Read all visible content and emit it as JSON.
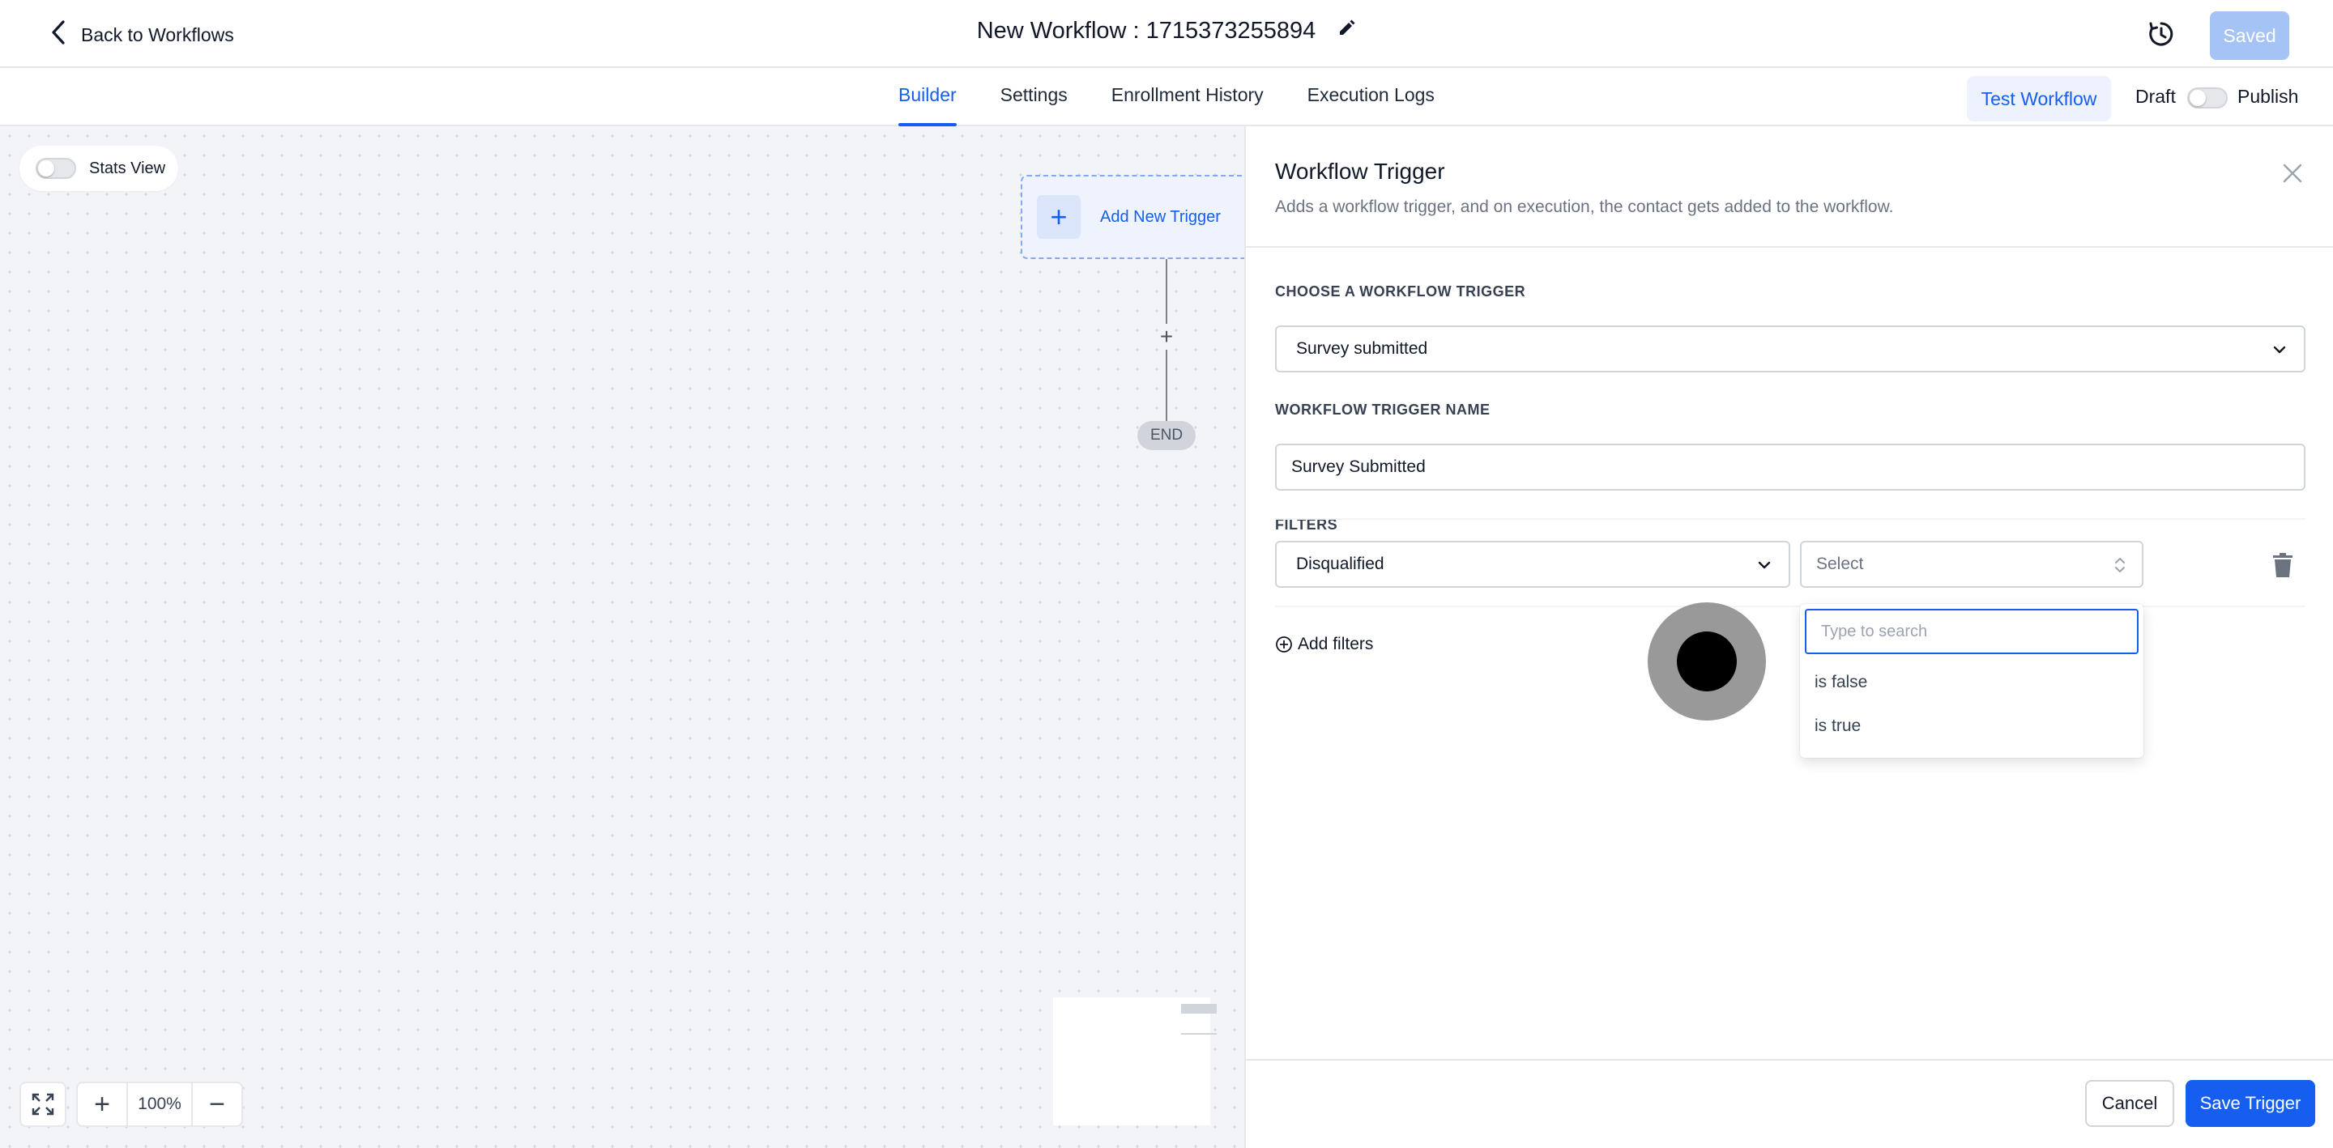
{
  "header": {
    "back_label": "Back to Workflows",
    "workflow_title": "New Workflow : 1715373255894",
    "saved_label": "Saved"
  },
  "tabs": [
    {
      "label": "Builder",
      "active": true
    },
    {
      "label": "Settings",
      "active": false
    },
    {
      "label": "Enrollment History",
      "active": false
    },
    {
      "label": "Execution Logs",
      "active": false
    }
  ],
  "actions": {
    "test_workflow_label": "Test Workflow",
    "draft_label": "Draft",
    "publish_label": "Publish"
  },
  "canvas": {
    "stats_view_label": "Stats View",
    "add_trigger_label": "Add New Trigger",
    "end_label": "END",
    "zoom_level": "100%"
  },
  "panel": {
    "title": "Workflow Trigger",
    "subtitle": "Adds a workflow trigger, and on execution, the contact gets added to the workflow.",
    "choose_trigger_label": "CHOOSE A WORKFLOW TRIGGER",
    "trigger_value": "Survey submitted",
    "trigger_name_label": "WORKFLOW TRIGGER NAME",
    "trigger_name_value": "Survey Submitted",
    "filters_label": "FILTERS",
    "filter_field_value": "Disqualified",
    "filter_operator_placeholder": "Select",
    "search_placeholder": "Type to search",
    "options": [
      "is false",
      "is true"
    ],
    "add_filters_label": "Add filters",
    "cancel_label": "Cancel",
    "save_label": "Save Trigger"
  },
  "colors": {
    "primary": "#155eef",
    "saved_disabled": "#a5c3f5",
    "canvas_bg": "#f3f4f7"
  }
}
